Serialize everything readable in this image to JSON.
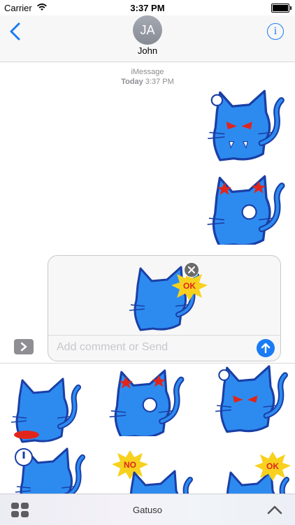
{
  "status_bar": {
    "carrier": "Carrier",
    "time": "3:37 PM"
  },
  "header": {
    "avatar_initials": "JA",
    "contact_name": "John"
  },
  "conversation": {
    "service": "iMessage",
    "day": "Today",
    "time": "3:37 PM"
  },
  "compose": {
    "placeholder": "Add comment or Send"
  },
  "stickers": {
    "sent": [
      "angry cat sticker",
      "dizzy cat sticker"
    ],
    "preview": {
      "badge_text": "OK"
    },
    "drawer_badges": {
      "no": "NO",
      "ok": "OK"
    }
  },
  "bottom_bar": {
    "app_name": "Gatuso"
  },
  "colors": {
    "accent": "#1a7cf5",
    "cat_blue": "#2d8bf0",
    "cat_outline": "#1a3fa6",
    "star": "#f7d11e"
  }
}
